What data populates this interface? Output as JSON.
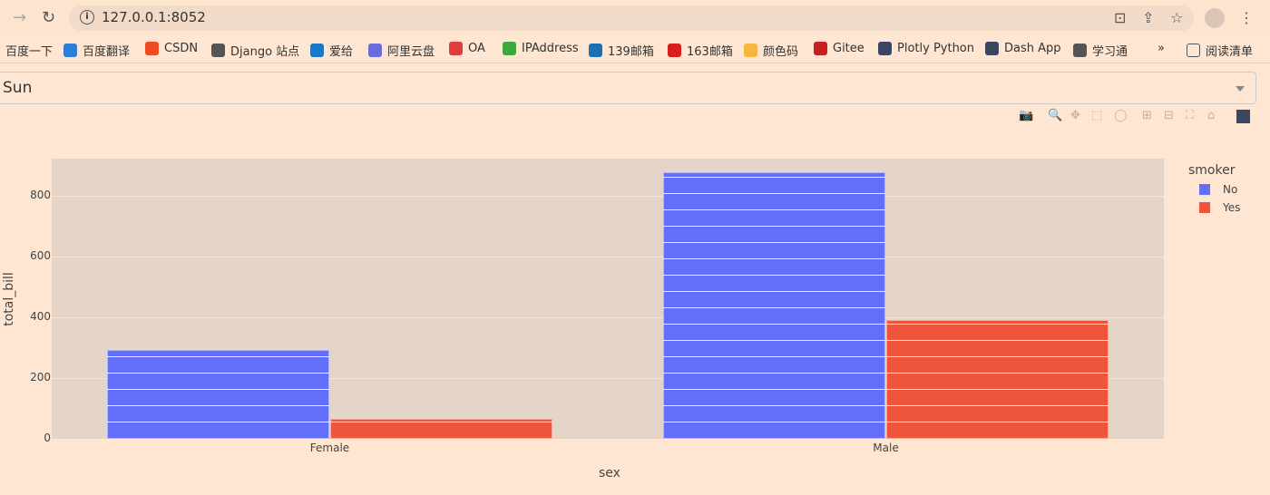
{
  "browser": {
    "url": "127.0.0.1:8052",
    "bookmarks": [
      {
        "label": "百度一下",
        "color": "transparent"
      },
      {
        "label": "百度翻译",
        "color": "#2d7fd5"
      },
      {
        "label": "CSDN",
        "color": "#f04a24"
      },
      {
        "label": "Django 站点",
        "color": "#555555"
      },
      {
        "label": "爱给",
        "color": "#1b78c8"
      },
      {
        "label": "阿里云盘",
        "color": "#6c6cd8"
      },
      {
        "label": "OA",
        "color": "#e03c3c"
      },
      {
        "label": "IPAddress",
        "color": "#3ea83e"
      },
      {
        "label": "139邮箱",
        "color": "#1a6fb5"
      },
      {
        "label": "163邮箱",
        "color": "#d81e1e"
      },
      {
        "label": "颜色码",
        "color": "#f6b73c"
      },
      {
        "label": "Gitee",
        "color": "#c71d23"
      },
      {
        "label": "Plotly Python",
        "color": "#3b4660"
      },
      {
        "label": "Dash App",
        "color": "#3b4660"
      },
      {
        "label": "学习通",
        "color": "#555555"
      }
    ],
    "more": "»",
    "reading_list": "阅读清单"
  },
  "dropdown": {
    "value": "Sun"
  },
  "chart_data": {
    "type": "bar",
    "barmode": "group",
    "categories": [
      "Female",
      "Male"
    ],
    "xlabel": "sex",
    "ylabel": "total_bill",
    "ylim": [
      0,
      922
    ],
    "yticks": [
      0,
      200,
      400,
      600,
      800
    ],
    "grid": true,
    "legend_title": "smoker",
    "legend_position": "right",
    "series": [
      {
        "name": "No",
        "color": "#636efa",
        "values": [
          291,
          878
        ]
      },
      {
        "name": "Yes",
        "color": "#ef553b",
        "values": [
          66,
          392
        ]
      }
    ]
  }
}
